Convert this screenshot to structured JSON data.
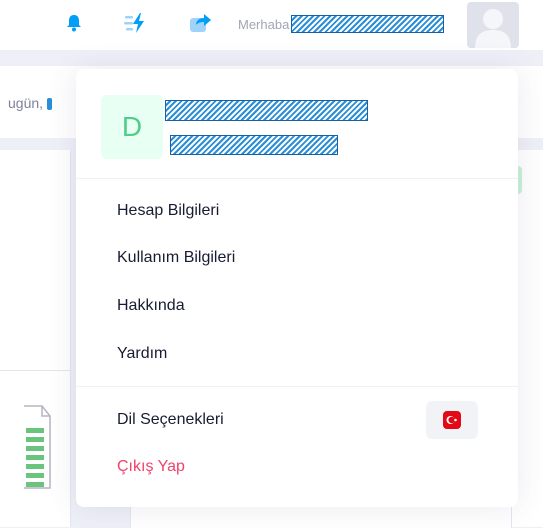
{
  "greeting": {
    "label": "Merhaba"
  },
  "subheader": {
    "text": "ugün,"
  },
  "menu": {
    "avatar_initial": "D",
    "items": [
      {
        "label": "Hesap Bilgileri"
      },
      {
        "label": "Kullanım Bilgileri"
      },
      {
        "label": "Hakkında"
      },
      {
        "label": "Yardım"
      }
    ],
    "language_label": "Dil Seçenekleri",
    "logout_label": "Çıkış Yap"
  },
  "icons": {
    "notification": "bell-icon",
    "quick_actions": "flash-icon",
    "share": "share-icon",
    "language_flag": "turkey-flag-icon",
    "user": "user-avatar-icon"
  },
  "colors": {
    "accent": "#009ef7",
    "success": "#50cd89",
    "danger": "#f1416c",
    "text": "#181c32"
  }
}
